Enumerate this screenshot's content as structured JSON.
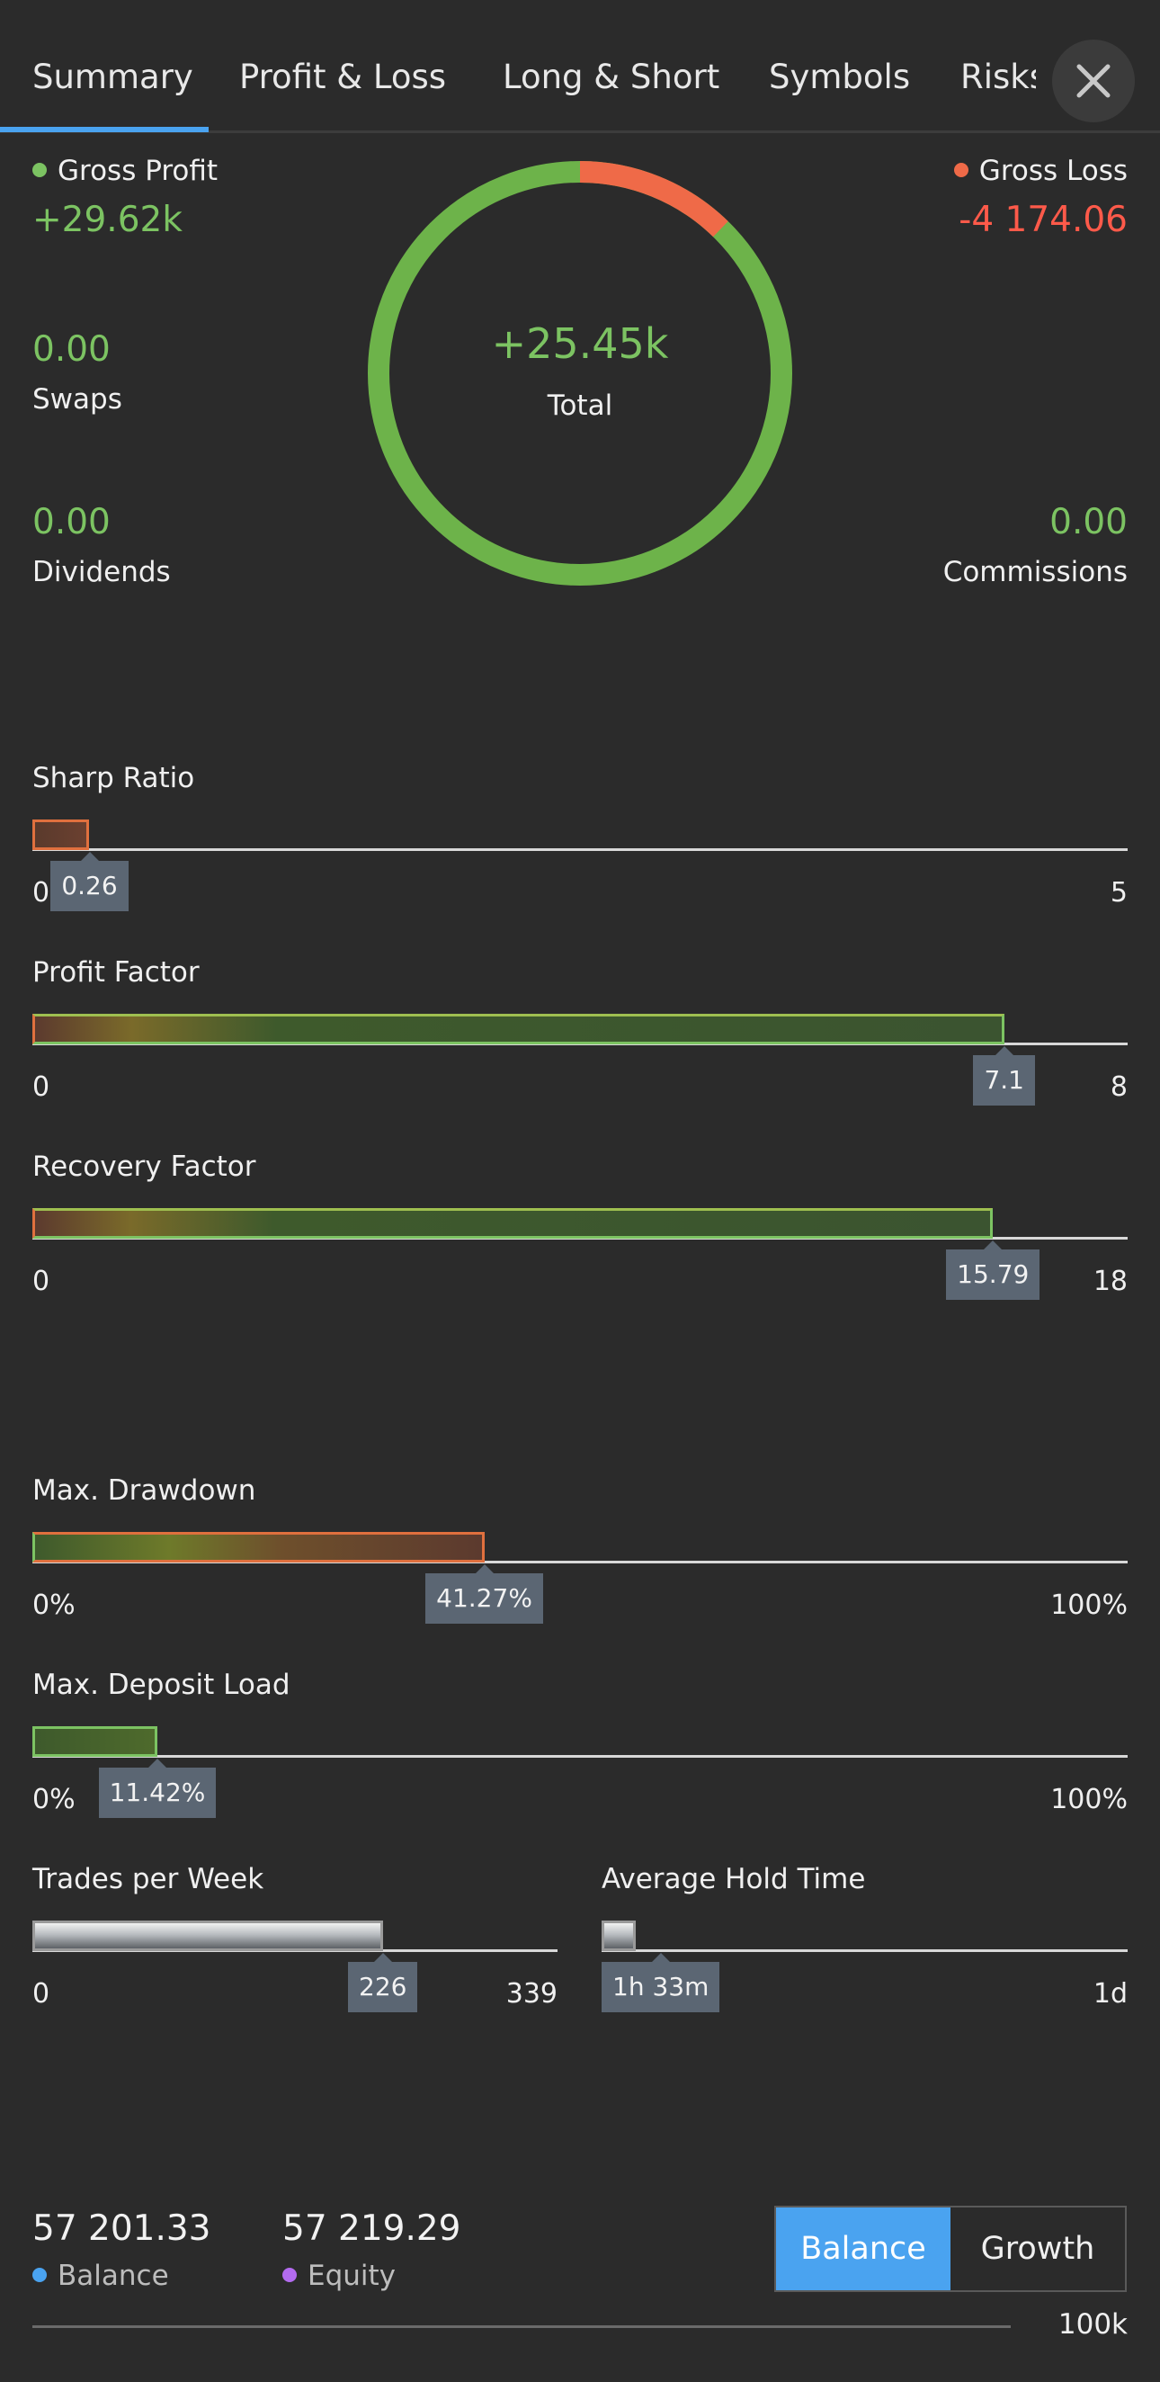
{
  "tabs": [
    {
      "label": "Summary"
    },
    {
      "label": "Profit & Loss"
    },
    {
      "label": "Long & Short"
    },
    {
      "label": "Symbols"
    },
    {
      "label": "Risks"
    }
  ],
  "summary": {
    "gross_profit": {
      "label": "Gross Profit",
      "value": "+29.62k",
      "dot_color": "#7cc362"
    },
    "gross_loss": {
      "label": "Gross Loss",
      "value": "-4 174.06",
      "dot_color": "#ef6a48"
    },
    "swaps": {
      "label": "Swaps",
      "value": "0.00"
    },
    "dividends": {
      "label": "Dividends",
      "value": "0.00"
    },
    "commissions": {
      "label": "Commissions",
      "value": "0.00"
    },
    "total": {
      "label": "Total",
      "value": "+25.45k"
    },
    "ring": {
      "profit_color": "#6db34a",
      "loss_color": "#ef6a48",
      "loss_fraction": 0.123
    }
  },
  "metrics": {
    "sharp_ratio": {
      "title": "Sharp Ratio",
      "value": "0.26",
      "min": "0",
      "max": "5",
      "fraction": 0.052
    },
    "profit_factor": {
      "title": "Profit Factor",
      "value": "7.1",
      "min": "0",
      "max": "8",
      "fraction": 0.8875
    },
    "recovery_factor": {
      "title": "Recovery Factor",
      "value": "15.79",
      "min": "0",
      "max": "18",
      "fraction": 0.877
    },
    "max_drawdown": {
      "title": "Max. Drawdown",
      "value": "41.27%",
      "min": "0%",
      "max": "100%",
      "fraction": 0.4127
    },
    "max_deposit_load": {
      "title": "Max. Deposit Load",
      "value": "11.42%",
      "min": "0%",
      "max": "100%",
      "fraction": 0.1142
    },
    "trades_per_week": {
      "title": "Trades per Week",
      "value": "226",
      "min": "0",
      "max": "339",
      "fraction": 0.667
    },
    "avg_hold_time": {
      "title": "Average Hold Time",
      "value": "1h 33m",
      "min": "",
      "max": "1d",
      "fraction": 0.065
    }
  },
  "bottom": {
    "balance": {
      "value": "57 201.33",
      "label": "Balance",
      "dot_color": "#4aa3f0"
    },
    "equity": {
      "value": "57 219.29",
      "label": "Equity",
      "dot_color": "#b36bf0"
    },
    "toggle": {
      "balance": "Balance",
      "growth": "Growth"
    },
    "axis_max": "100k"
  },
  "colors": {
    "background": "#2b2b2b",
    "accent": "#4aa3f0",
    "green": "#7cc362",
    "red": "#ff5a4a"
  }
}
